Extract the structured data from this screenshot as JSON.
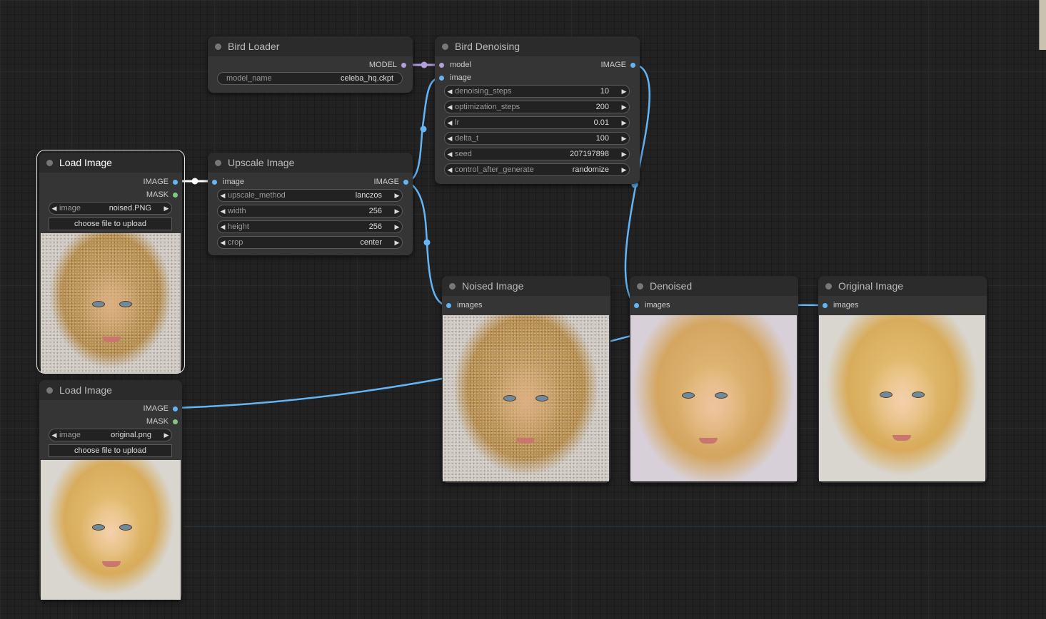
{
  "nodes": {
    "bird_loader": {
      "title": "Bird Loader",
      "output": "MODEL",
      "widget": {
        "label": "model_name",
        "value": "celeba_hq.ckpt"
      }
    },
    "bird_denoising": {
      "title": "Bird Denoising",
      "inputs": [
        "model",
        "image"
      ],
      "output": "IMAGE",
      "widgets": [
        {
          "label": "denoising_steps",
          "value": "10"
        },
        {
          "label": "optimization_steps",
          "value": "200"
        },
        {
          "label": "lr",
          "value": "0.01"
        },
        {
          "label": "delta_t",
          "value": "100"
        },
        {
          "label": "seed",
          "value": "207197898"
        },
        {
          "label": "control_after_generate",
          "value": "randomize"
        }
      ]
    },
    "load_image_1": {
      "title": "Load Image",
      "outputs": [
        "IMAGE",
        "MASK"
      ],
      "widget": {
        "label": "image",
        "value": "noised.PNG"
      },
      "upload_label": "choose file to upload"
    },
    "load_image_2": {
      "title": "Load Image",
      "outputs": [
        "IMAGE",
        "MASK"
      ],
      "widget": {
        "label": "image",
        "value": "original.png"
      },
      "upload_label": "choose file to upload"
    },
    "upscale_image": {
      "title": "Upscale Image",
      "input": "image",
      "output": "IMAGE",
      "widgets": [
        {
          "label": "upscale_method",
          "value": "lanczos"
        },
        {
          "label": "width",
          "value": "256"
        },
        {
          "label": "height",
          "value": "256"
        },
        {
          "label": "crop",
          "value": "center"
        }
      ]
    },
    "noised_image": {
      "title": "Noised Image",
      "input": "images"
    },
    "denoised": {
      "title": "Denoised",
      "input": "images"
    },
    "original_image": {
      "title": "Original Image",
      "input": "images"
    }
  },
  "colors": {
    "image_link": "#64b5f6",
    "model_link": "#b39ddb",
    "selected_link": "#ffffff",
    "canvas": "#222222",
    "node_body": "#353535",
    "node_title": "#2b2b2b"
  },
  "icons": {
    "arrow_left": "left-triangle",
    "arrow_right": "right-triangle",
    "title_dot": "circle"
  }
}
